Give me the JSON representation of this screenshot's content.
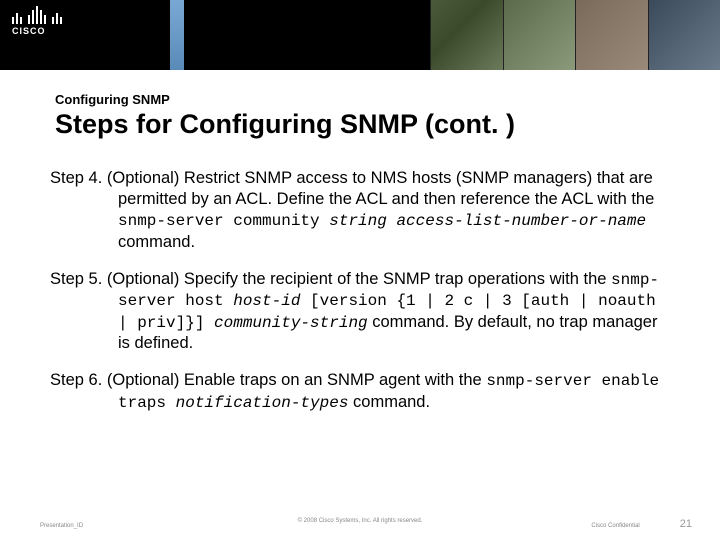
{
  "brand": "CISCO",
  "header": {
    "section": "Configuring SNMP",
    "title": "Steps for Configuring SNMP (cont. )"
  },
  "steps": {
    "s4": {
      "lead": "Step 4.",
      "p1a": "(Optional) Restrict SNMP access to NMS hosts (SNMP managers) that are permitted by an ACL. Define the ACL and then reference the ACL with the ",
      "code1": "snmp-server community",
      "code2": " string access-list-number-or-name",
      "p1b": " command."
    },
    "s5": {
      "lead": "Step 5.",
      "p1a": "(Optional) Specify the recipient of the SNMP trap operations with the ",
      "code1": "snmp-server host ",
      "code1i": "host-id",
      "code2": " [version {1 | 2 c | 3 [auth | noauth | priv]}] ",
      "code2i": "community-string",
      "p1b": " command. By default, no trap manager is defined."
    },
    "s6": {
      "lead": "Step 6.",
      "p1a": "(Optional) Enable traps on an SNMP agent with the ",
      "code1": "snmp-server enable traps ",
      "code1i": "notification-types",
      "p1b": " command."
    }
  },
  "footer": {
    "left": "Presentation_ID",
    "center": "© 2008 Cisco Systems, Inc. All rights reserved.",
    "conf": "Cisco Confidential",
    "page": "21"
  }
}
